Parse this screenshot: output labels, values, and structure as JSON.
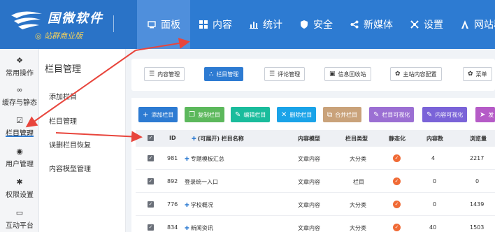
{
  "brand": {
    "name": "国微软件",
    "edition": "站群商业版"
  },
  "nav": {
    "items": [
      {
        "label": "面板",
        "icon": "monitor-icon"
      },
      {
        "label": "内容",
        "icon": "grid-icon"
      },
      {
        "label": "统计",
        "icon": "bar-chart-icon"
      },
      {
        "label": "安全",
        "icon": "shield-icon"
      },
      {
        "label": "新媒体",
        "icon": "share-icon"
      },
      {
        "label": "设置",
        "icon": "settings-icon"
      },
      {
        "label": "网站群",
        "icon": "sitemap-icon"
      }
    ],
    "active_index": 0
  },
  "rail": {
    "items": [
      {
        "label": "常用操作",
        "icon": "settings-icon"
      },
      {
        "label": "缓存与静态",
        "icon": "link-icon"
      },
      {
        "label": "栏目管理",
        "icon": "checkbox-icon"
      },
      {
        "label": "用户管理",
        "icon": "user-icon"
      },
      {
        "label": "权限设置",
        "icon": "gear-icon"
      },
      {
        "label": "互动平台",
        "icon": "message-icon"
      }
    ],
    "active_index": 2
  },
  "submenu": {
    "title": "栏目管理",
    "items": [
      "添加栏目",
      "栏目管理",
      "误删栏目恢复",
      "内容模型管理"
    ]
  },
  "tabs": [
    {
      "label": "内容管理",
      "icon": "list-icon",
      "active": false
    },
    {
      "label": "栏目管理",
      "icon": "sitemap-icon",
      "active": true
    },
    {
      "label": "评论管理",
      "icon": "list-icon",
      "active": false
    },
    {
      "label": "信息回收站",
      "icon": "trash-icon",
      "active": false
    },
    {
      "label": "主站内容配置",
      "icon": "gear-icon",
      "active": false
    },
    {
      "label": "菜单",
      "icon": "gear-icon",
      "active": false
    }
  ],
  "actions": [
    {
      "label": "添加栏目",
      "icon": "plus-icon",
      "color": "#2d7bd2"
    },
    {
      "label": "复制栏目",
      "icon": "copy-icon",
      "color": "#5cb85c"
    },
    {
      "label": "编辑栏目",
      "icon": "edit-icon",
      "color": "#1abc9c"
    },
    {
      "label": "删除栏目",
      "icon": "close-icon",
      "color": "#1aa3e8"
    },
    {
      "label": "合并栏目",
      "icon": "merge-icon",
      "color": "#c9a27a"
    },
    {
      "label": "栏目可视化",
      "icon": "edit-icon",
      "color": "#9b6fd3"
    },
    {
      "label": "内容可视化",
      "icon": "edit-icon",
      "color": "#7a63d8"
    },
    {
      "label": "发",
      "icon": "send-icon",
      "color": "#b55bc7"
    }
  ],
  "table": {
    "headers": {
      "id": "ID",
      "name": "(可展开) 栏目名称",
      "model": "内容模型",
      "type": "栏目类型",
      "static": "静态化",
      "count": "内容数",
      "views": "浏览量"
    },
    "rows": [
      {
        "id": "981",
        "name": "专题模板汇总",
        "expandable": true,
        "model": "文章内容",
        "type": "大分类",
        "count": "4",
        "views": "2217"
      },
      {
        "id": "892",
        "name": "登录统一入口",
        "expandable": false,
        "model": "文章内容",
        "type": "栏目",
        "count": "0",
        "views": "0"
      },
      {
        "id": "776",
        "name": "学校概况",
        "expandable": true,
        "model": "文章内容",
        "type": "大分类",
        "count": "0",
        "views": "1439"
      },
      {
        "id": "834",
        "name": "新闻资讯",
        "expandable": true,
        "model": "文章内容",
        "type": "大分类",
        "count": "40",
        "views": "1503"
      }
    ]
  },
  "colors": {
    "topbar": "#2d7bd2",
    "accent": "#2d7bd2",
    "arrow": "#e8453c"
  }
}
